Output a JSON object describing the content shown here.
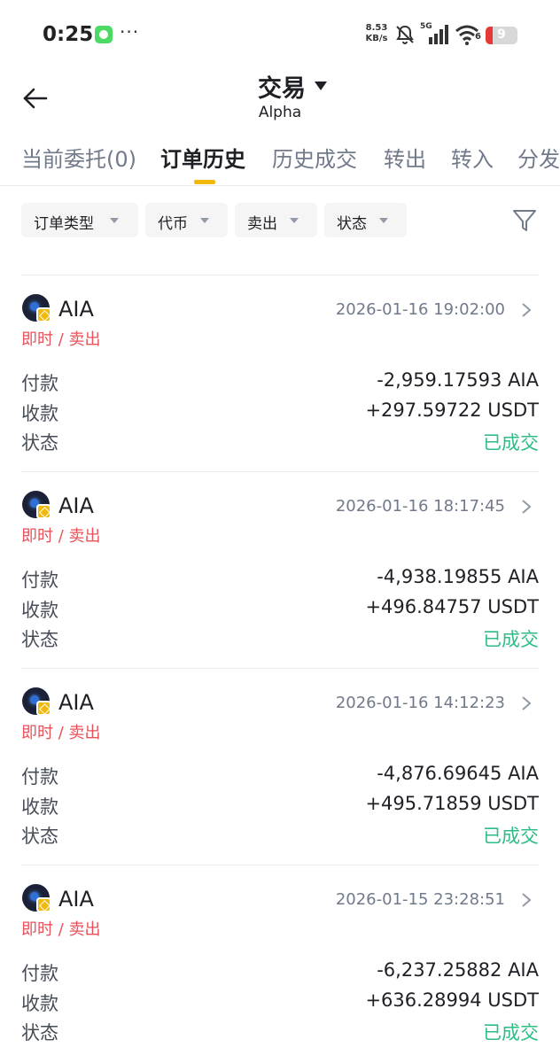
{
  "status_bar": {
    "time": "0:25",
    "more": "···",
    "net_speed_value": "8.53",
    "net_speed_unit": "KB/s",
    "network": "5G",
    "wifi_badge": "6",
    "battery": "9"
  },
  "header": {
    "title": "交易",
    "subtitle": "Alpha"
  },
  "tabs": [
    {
      "label": "当前委托(0)",
      "active": false
    },
    {
      "label": "订单历史",
      "active": true
    },
    {
      "label": "历史成交",
      "active": false
    },
    {
      "label": "转出",
      "active": false
    },
    {
      "label": "转入",
      "active": false
    },
    {
      "label": "分发",
      "active": false
    }
  ],
  "filters": [
    {
      "label": "订单类型"
    },
    {
      "label": "代币"
    },
    {
      "label": "卖出"
    },
    {
      "label": "状态"
    }
  ],
  "colors": {
    "accent": "#f0b90b",
    "sell": "#e8525b",
    "success": "#2ebd85"
  },
  "orders": [
    {
      "coin": "AIA",
      "time": "2026-01-16 19:02:00",
      "type": "即时 / 卖出",
      "pay_label": "付款",
      "pay_value": "-2,959.17593 AIA",
      "receive_label": "收款",
      "receive_value": "+297.59722 USDT",
      "status_label": "状态",
      "status_value": "已成交"
    },
    {
      "coin": "AIA",
      "time": "2026-01-16 18:17:45",
      "type": "即时 / 卖出",
      "pay_label": "付款",
      "pay_value": "-4,938.19855 AIA",
      "receive_label": "收款",
      "receive_value": "+496.84757 USDT",
      "status_label": "状态",
      "status_value": "已成交"
    },
    {
      "coin": "AIA",
      "time": "2026-01-16 14:12:23",
      "type": "即时 / 卖出",
      "pay_label": "付款",
      "pay_value": "-4,876.69645 AIA",
      "receive_label": "收款",
      "receive_value": "+495.71859 USDT",
      "status_label": "状态",
      "status_value": "已成交"
    },
    {
      "coin": "AIA",
      "time": "2026-01-15 23:28:51",
      "type": "即时 / 卖出",
      "pay_label": "付款",
      "pay_value": "-6,237.25882 AIA",
      "receive_label": "收款",
      "receive_value": "+636.28994 USDT",
      "status_label": "状态",
      "status_value": "已成交"
    }
  ]
}
